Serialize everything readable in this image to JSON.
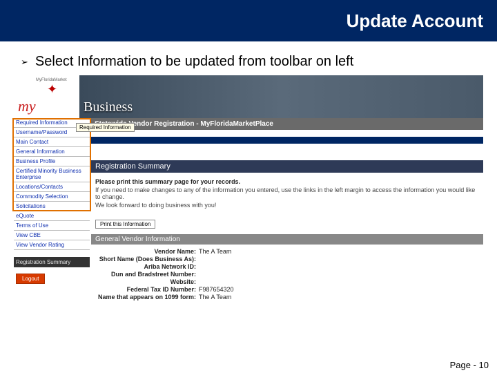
{
  "header": {
    "title": "Update Account"
  },
  "bullet": {
    "glyph": "➢",
    "text": "Select Information to be updated from toolbar on left"
  },
  "logo": {
    "sub": "MyFloridaMarket",
    "script": "my",
    "star": "✦"
  },
  "banner": {
    "label": "Business"
  },
  "sidebar": {
    "items": [
      "Required Information",
      "Username/Password",
      "Main Contact",
      "General Information",
      "Business Profile",
      "Certified Minority Business Enterprise",
      "Locations/Contacts",
      "Commodity Selection",
      "Solicitations",
      "eQuote",
      "Terms of Use",
      "View CBE",
      "View Vendor Rating"
    ],
    "summary": "Registration Summary",
    "logout": "Logout"
  },
  "tooltip": "Required Information",
  "main": {
    "bar": "Statewide Vendor Registration - MyFloridaMarketPlace",
    "regSummary": "Registration Summary",
    "line1": "Please print this summary page for your records.",
    "line2": "If you need to make changes to any of the information you entered, use the links in the left margin to access the information you would like to change.",
    "line3": "We look forward to doing business with you!",
    "printBtn": "Print this Information",
    "gvi": "General Vendor Information",
    "fields": [
      {
        "label": "Vendor Name:",
        "value": "The A Team"
      },
      {
        "label": "Short Name (Does Business As):",
        "value": ""
      },
      {
        "label": "Ariba Network ID:",
        "value": ""
      },
      {
        "label": "Dun and Bradstreet Number:",
        "value": ""
      },
      {
        "label": "Website:",
        "value": ""
      },
      {
        "label": "Federal Tax ID Number:",
        "value": "F987654320"
      },
      {
        "label": "Name that appears on 1099 form:",
        "value": "The A Team"
      }
    ]
  },
  "footer": "Page - 10"
}
